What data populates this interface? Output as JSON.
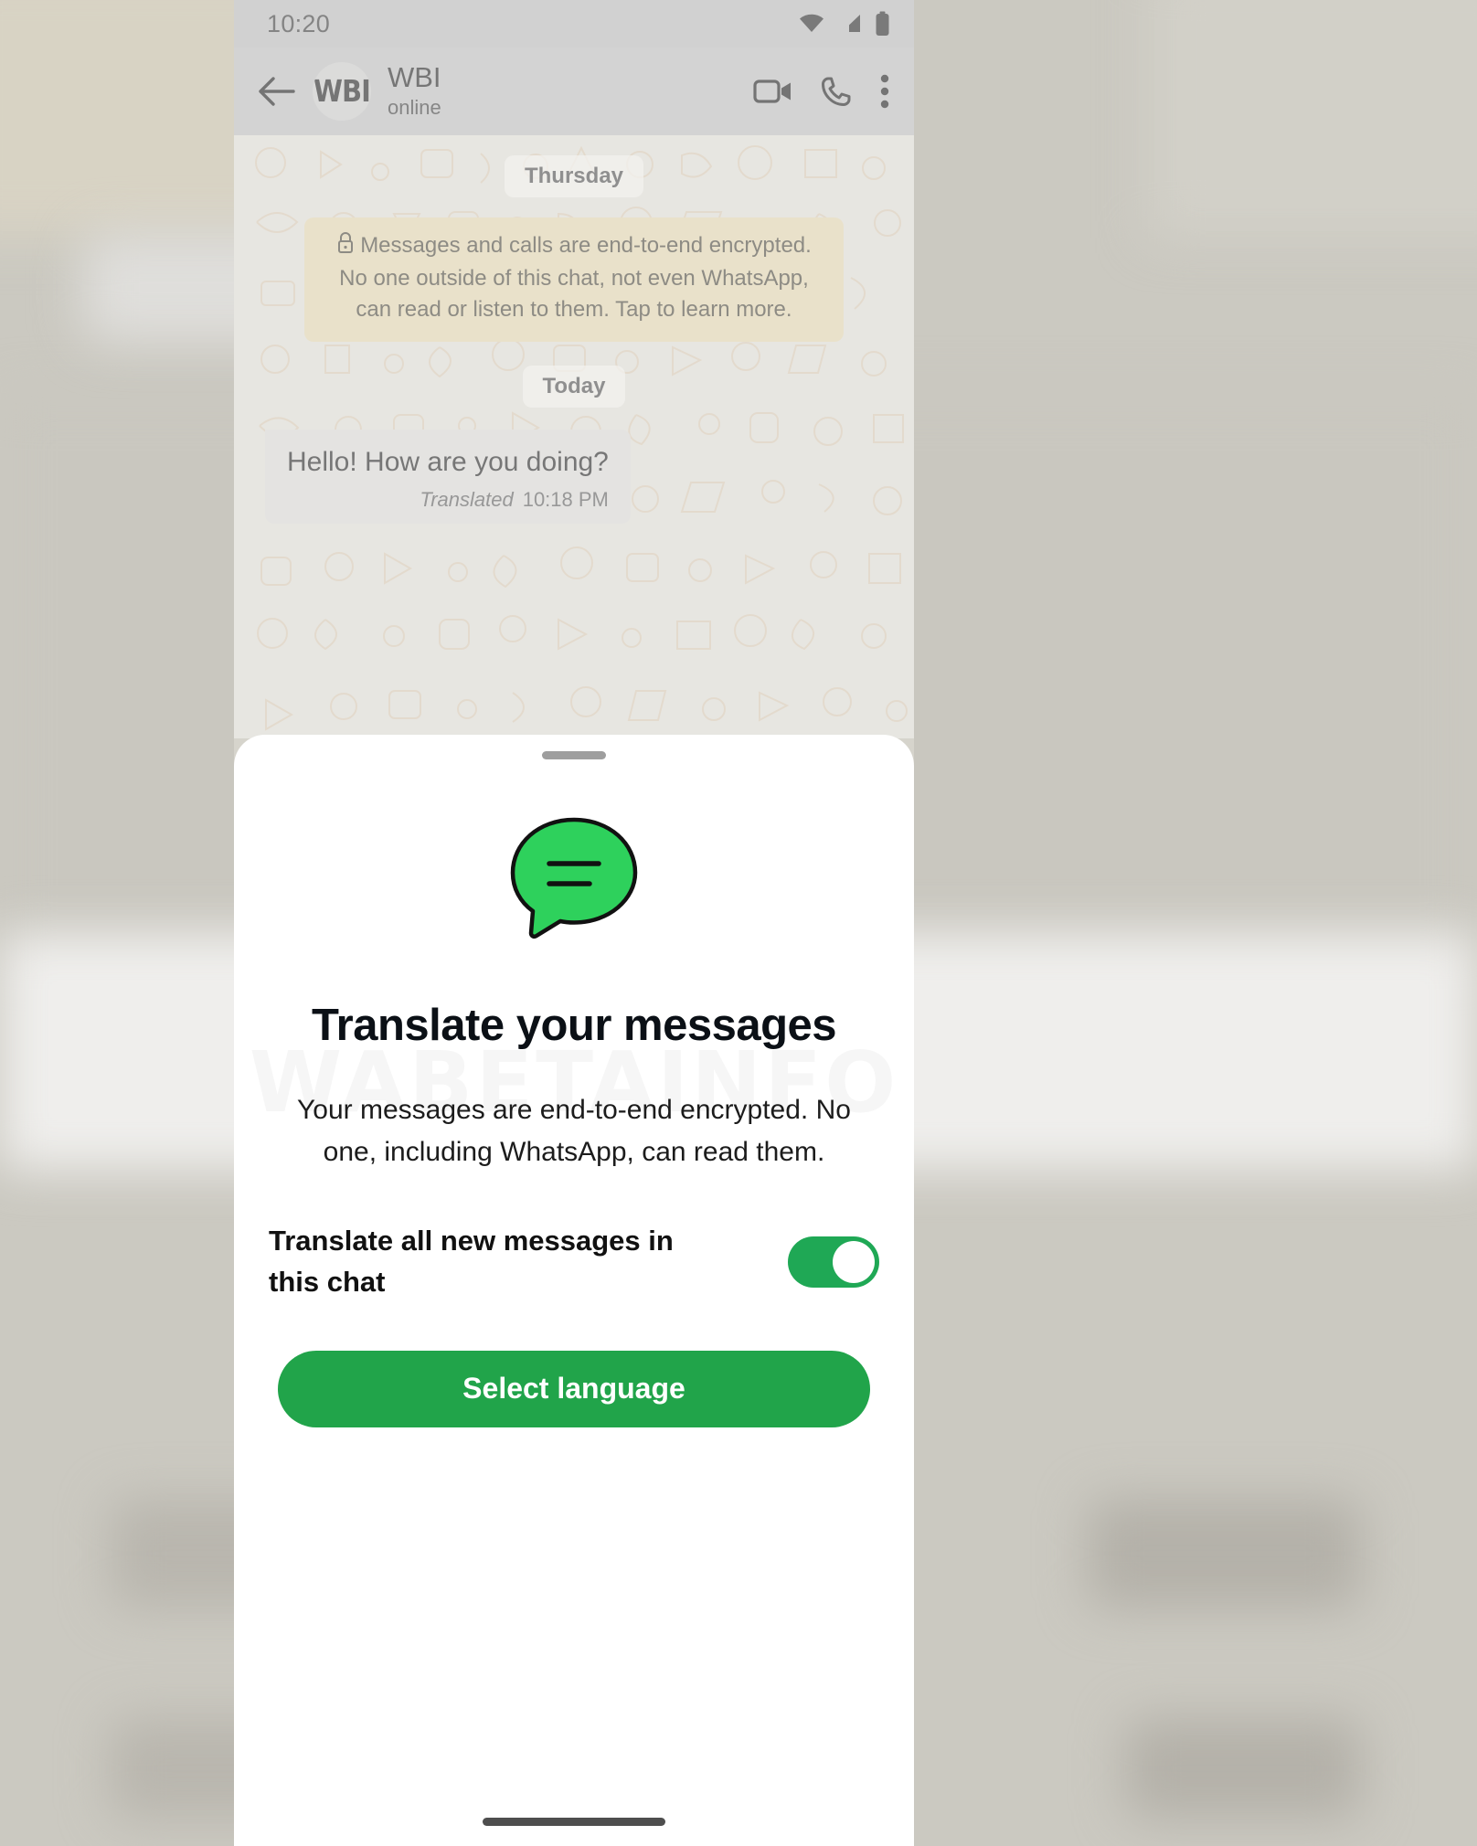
{
  "status_bar": {
    "time": "10:20",
    "icons": [
      "wifi-icon",
      "cellular-signal-icon",
      "battery-icon"
    ]
  },
  "chat_header": {
    "back_icon": "back-arrow-icon",
    "avatar_text": "WBI",
    "title": "WBI",
    "subtitle": "online",
    "actions": [
      "video-call-icon",
      "voice-call-icon",
      "more-options-icon"
    ]
  },
  "chat": {
    "date_divider_1": "Thursday",
    "date_divider_2": "Today",
    "encryption_notice": "Messages and calls are end-to-end encrypted. No one outside of this chat, not even WhatsApp, can read or listen to them. Tap to learn more.",
    "encryption_icon": "lock-icon",
    "message": {
      "text": "Hello! How are you doing?",
      "translated_label": "Translated",
      "time": "10:18 PM"
    }
  },
  "sheet": {
    "handle": "drag-handle",
    "icon": "whatsapp-translate-bubble-icon",
    "title": "Translate your messages",
    "description": "Your messages are end-to-end encrypted. No one, including WhatsApp, can read them.",
    "toggle_label": "Translate all new messages in this chat",
    "toggle_state": "on",
    "button_label": "Select language",
    "watermark": "WABETAINFO"
  },
  "colors": {
    "accent_green": "#21a44a",
    "toggle_green": "#1fa855",
    "status_bar_bg": "#b0b0b0",
    "header_bg": "#b4b4b4",
    "chat_bg": "#d6d4cc",
    "encryption_bg": "#d9cca4",
    "bubble_bg": "#d0cfcb"
  }
}
